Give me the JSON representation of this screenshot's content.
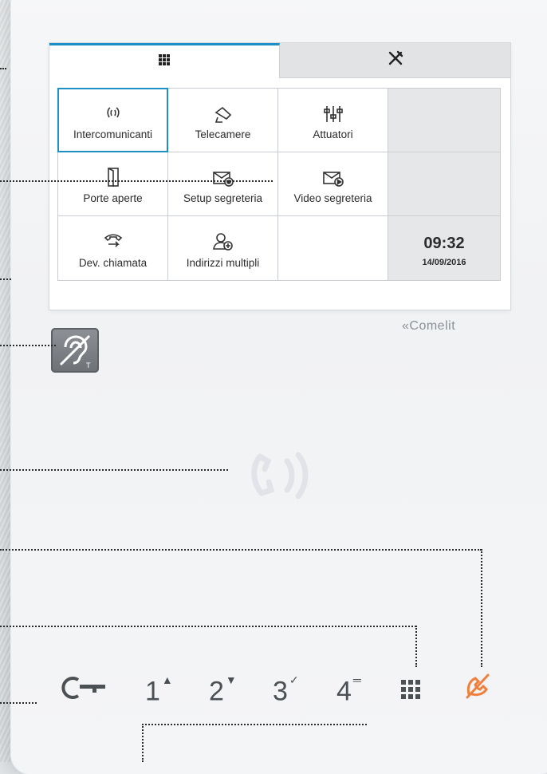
{
  "brand": "«Comelit",
  "tabs": [
    {
      "name": "home",
      "icon": "grid-icon",
      "active": true
    },
    {
      "name": "settings",
      "icon": "tools-icon",
      "active": false
    }
  ],
  "menu": {
    "intercom_label": "Intercomunicanti",
    "cameras_label": "Telecamere",
    "actuators_label": "Attuatori",
    "open_doors_label": "Porte aperte",
    "vm_setup_label": "Setup segreteria",
    "video_vm_label": "Video segreteria",
    "call_divert_label": "Dev. chiamata",
    "multi_address_label": "Indirizzi multipli"
  },
  "clock": {
    "time": "09:32",
    "date": "14/09/2016"
  },
  "keys": {
    "key1": "1",
    "key2": "2",
    "key3": "3",
    "key4": "4"
  },
  "colors": {
    "accent": "#1c8fc4",
    "mute": "#f07f3c",
    "panel": "#e6e7e9"
  }
}
